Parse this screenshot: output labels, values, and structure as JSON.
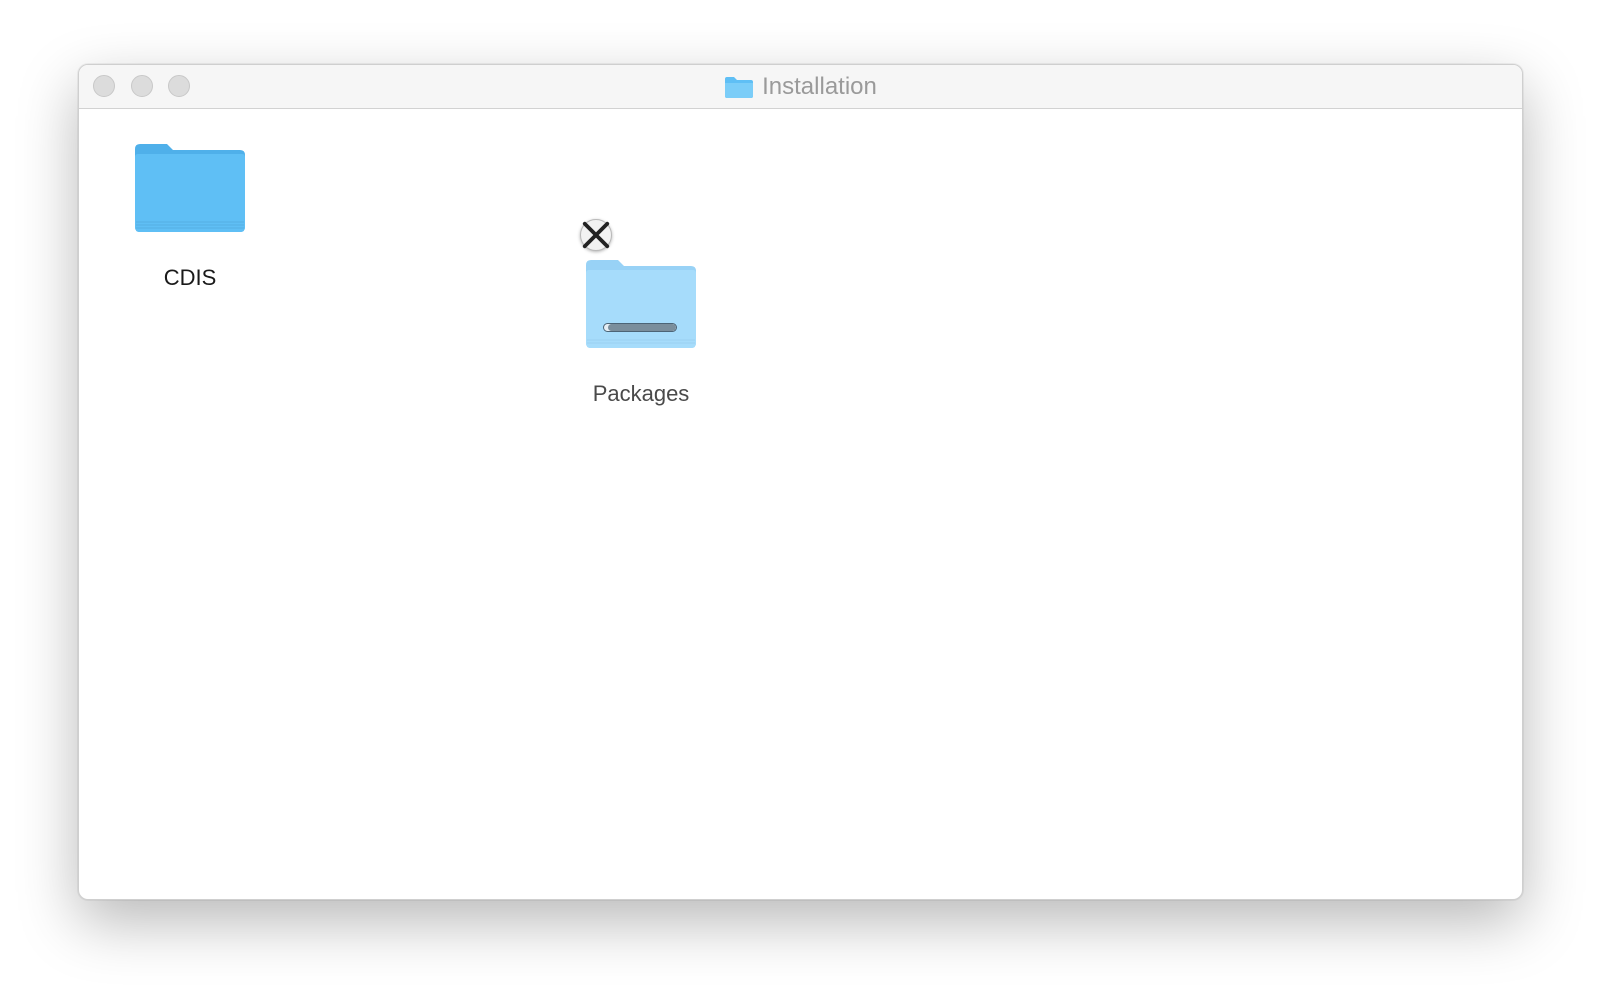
{
  "window": {
    "title": "Installation",
    "title_icon": "folder-icon"
  },
  "colors": {
    "folder_blue": "#5fbff5",
    "folder_blue_light": "#a6dcfb"
  },
  "items": [
    {
      "name": "CDIS",
      "icon": "folder-icon"
    },
    {
      "name": "Packages",
      "icon": "folder-icon",
      "state": "copying",
      "progress": 0.95,
      "cancel_icon": "close-icon"
    }
  ]
}
